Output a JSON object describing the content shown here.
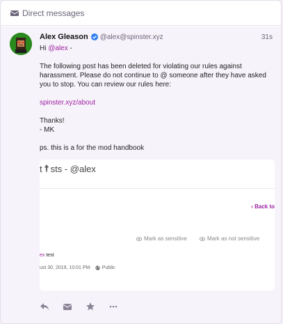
{
  "header": {
    "title": "Direct messages",
    "icon": "envelope-icon"
  },
  "status": {
    "author": {
      "display_name": "Alex Gleason",
      "handle": "@alex@spinster.xyz",
      "verified": true,
      "avatar": "pixel-art-avatar"
    },
    "timestamp": "31s",
    "body": {
      "greeting_prefix": "Hi ",
      "mention": "@alex",
      "greeting_suffix": " -",
      "paragraph": "The following post has been deleted for violating our rules against harassment. Please do not continue to @ someone after they have asked you to stop. You can review our rules here:",
      "link": "spinster.xyz/about",
      "thanks": "Thanks!",
      "signature": "- MK",
      "ps": "ps. this is a for the mod handbook"
    },
    "attachment": {
      "title_left": "t",
      "title_right": "sts - @alex",
      "back_link": "Back to",
      "mark_sensitive": "Mark as sensitive",
      "mark_not_sensitive": "Mark as not sensitive",
      "author_fragment": "ex",
      "post_text": " test",
      "date": "ust 30, 2019, 10:01 PM",
      "visibility": "Public"
    },
    "actions": [
      "reply-icon",
      "envelope-icon",
      "star-icon",
      "more-icon"
    ]
  },
  "colors": {
    "accent": "#9c1fa1",
    "muted": "#6a6378",
    "verified": "#2f7ff0"
  }
}
